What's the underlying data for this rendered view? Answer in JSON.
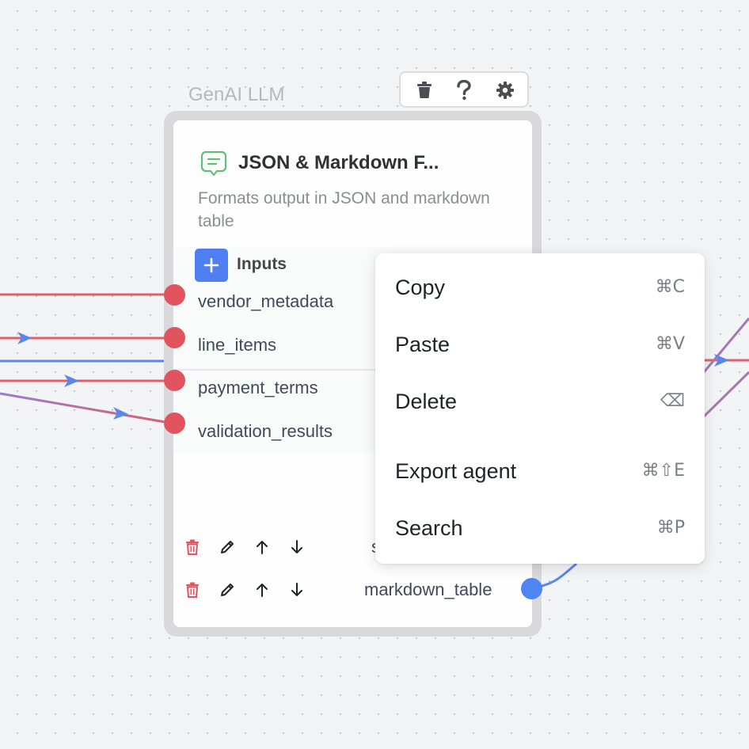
{
  "node": {
    "type_label": "GenAI LLM",
    "title": "JSON & Markdown F...",
    "description": "Formats output in JSON and markdown table",
    "inputs_label": "Inputs",
    "inputs": [
      "vendor_metadata",
      "line_items",
      "payment_terms",
      "validation_results"
    ],
    "outputs": [
      "s",
      "markdown_table"
    ],
    "toolbar": {
      "delete_icon": "trash-icon",
      "help_icon": "question-icon",
      "settings_icon": "gear-icon"
    }
  },
  "context_menu": {
    "items": [
      {
        "label": "Copy",
        "shortcut": "⌘C"
      },
      {
        "label": "Paste",
        "shortcut": "⌘V"
      },
      {
        "label": "Delete",
        "shortcut": "⌫"
      },
      {
        "label": "Export agent",
        "shortcut": "⌘⇧E"
      },
      {
        "label": "Search",
        "shortcut": "⌘P"
      }
    ]
  },
  "colors": {
    "edge_red": "#e0606a",
    "edge_blue": "#5b86ee",
    "edge_purple": "#a478b0",
    "accent_blue": "#4f7ff0",
    "handle_red": "#e0535f"
  }
}
